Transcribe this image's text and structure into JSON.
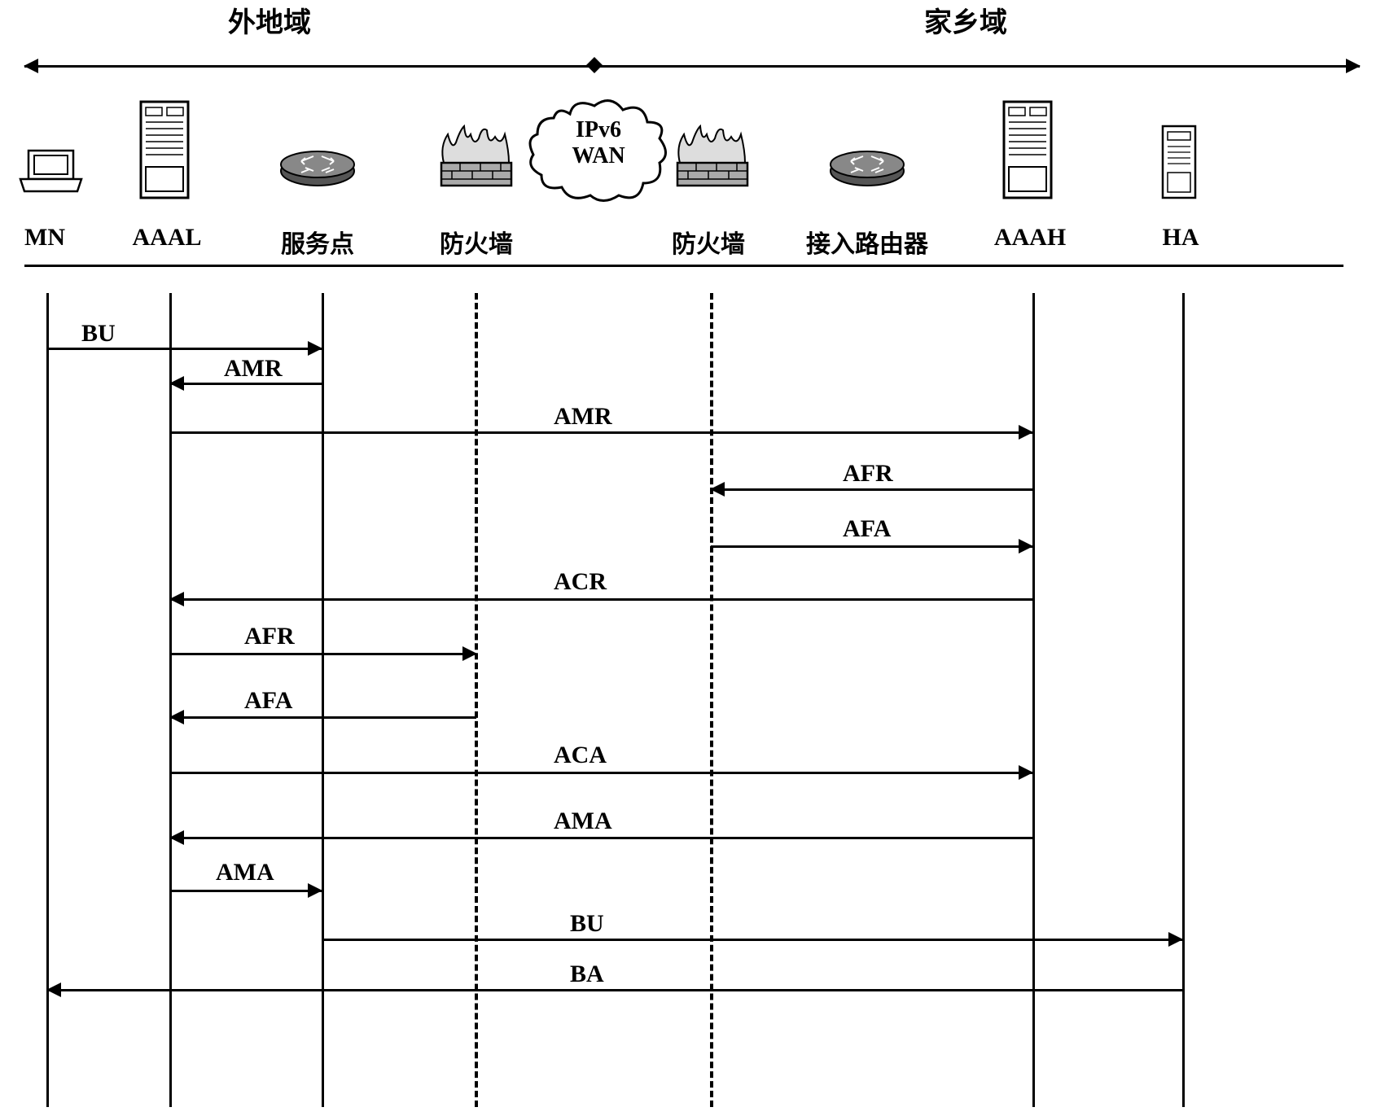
{
  "domains": {
    "foreign": "外地域",
    "home": "家乡域"
  },
  "nodes": {
    "mn": "MN",
    "aaal": "AAAL",
    "service_point": "服务点",
    "firewall_left": "防火墙",
    "firewall_right": "防火墙",
    "access_router": "接入路由器",
    "aaah": "AAAH",
    "ha": "HA"
  },
  "cloud": {
    "line1": "IPv6",
    "line2": "WAN"
  },
  "messages": {
    "bu1": "BU",
    "amr1": "AMR",
    "amr2": "AMR",
    "afr1": "AFR",
    "afa1": "AFA",
    "acr": "ACR",
    "afr2": "AFR",
    "afa2": "AFA",
    "aca": "ACA",
    "ama1": "AMA",
    "ama2": "AMA",
    "bu2": "BU",
    "ba": "BA"
  }
}
